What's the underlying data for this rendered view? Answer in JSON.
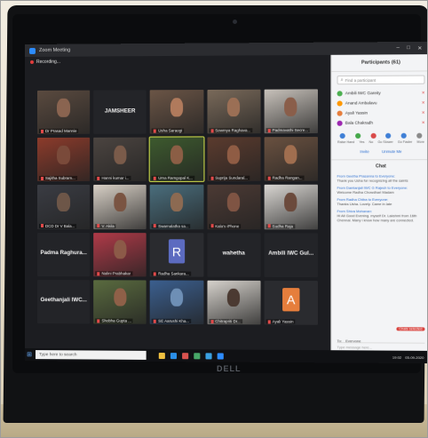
{
  "window": {
    "title": "Zoom Meeting",
    "controls": [
      "–",
      "□",
      "✕"
    ],
    "recording_label": "Recording..."
  },
  "gallery": {
    "tiles": [
      {
        "label": "Dr Prasad Mannie",
        "kind": "video",
        "bg": "#5a4a3f",
        "face": "#8a6450"
      },
      {
        "label": "JAMSHEER",
        "kind": "name"
      },
      {
        "label": "Usha Saraogi",
        "kind": "video",
        "bg": "#6b5546",
        "face": "#b07a5c"
      },
      {
        "label": "Sowmya Raghava...",
        "kind": "video",
        "bg": "#7a6a5a",
        "face": "#9b6f55"
      },
      {
        "label": "Padmavathi Secre...",
        "kind": "video",
        "bg": "#c8c2bb",
        "face": "#8a5e4a"
      },
      {
        "label": "Sajitha Subram...",
        "kind": "video",
        "bg": "#8c3b2b",
        "face": "#7a4a3a"
      },
      {
        "label": "Hanni kumar i...",
        "kind": "video",
        "bg": "#4b4440",
        "face": "#7a5b4a"
      },
      {
        "label": "Uma Ramgopal K...",
        "kind": "video",
        "bg": "#3d5a2e",
        "face": "#8b5e45",
        "active": true
      },
      {
        "label": "Suprija Sundaral...",
        "kind": "video",
        "bg": "#5b3b2e",
        "face": "#8f5c44"
      },
      {
        "label": "Radha Rangan...",
        "kind": "video",
        "bg": "#6a5140",
        "face": "#a06e4f"
      },
      {
        "label": "DCD Dr V Bala...",
        "kind": "video",
        "bg": "#3a3c43",
        "face": "#6d5648"
      },
      {
        "label": "V. Akila",
        "kind": "video",
        "bg": "#d8d0c6",
        "face": "#7a5442"
      },
      {
        "label": "Swarnalatha sa...",
        "kind": "video",
        "bg": "#4a6e7d",
        "face": "#8c6a52"
      },
      {
        "label": "Kala's iPhone",
        "kind": "video",
        "bg": "#4c3a34",
        "face": "#7f5443"
      },
      {
        "label": "Sudha Raja",
        "kind": "video",
        "bg": "#d9d6d2",
        "face": "#6b4a3c"
      },
      {
        "label": "Padma Raghura...",
        "kind": "name"
      },
      {
        "label": "Nalini Prabhakar",
        "kind": "video",
        "bg": "#b03a48",
        "face": "#8c5a48"
      },
      {
        "label": "Radha Sankara...",
        "kind": "letter",
        "letter": "R",
        "letter_bg": "#5c6bc0"
      },
      {
        "label": "wahetha",
        "kind": "name"
      },
      {
        "label": "Ambili IWC Gul...",
        "kind": "name"
      },
      {
        "label": "Geethanjali IWC...",
        "kind": "name"
      },
      {
        "label": "Shobha Gupta ...",
        "kind": "video",
        "bg": "#5a6b3f",
        "face": "#8f6048"
      },
      {
        "label": "SE Aarushi Kha...",
        "kind": "video",
        "bg": "#3b5f8f",
        "face": "#6e8fb5"
      },
      {
        "label": "Chitrapriti Dr...",
        "kind": "video",
        "bg": "#d6d2cc",
        "face": "#4b3a32"
      },
      {
        "label": "Ayali Yassin",
        "kind": "letter",
        "letter": "A",
        "letter_bg": "#e67e3c"
      }
    ]
  },
  "participants_panel": {
    "title": "Participants (61)",
    "search_placeholder": "Find a participant",
    "rows": [
      {
        "name": "Ambili IWC Gareity",
        "color": "#4caf50"
      },
      {
        "name": "Anand Ambalavu",
        "color": "#ff9800"
      },
      {
        "name": "Ayali Yassin",
        "color": "#e67e3c"
      },
      {
        "name": "Bala Chakradh",
        "color": "#9c27b0"
      }
    ],
    "reactions": [
      "Raise Hand",
      "Yes",
      "No",
      "Go Slower",
      "Go Faster",
      "More"
    ],
    "reaction_colors": [
      "#3f7fd6",
      "#45a84a",
      "#d94a4a",
      "#3f7fd6",
      "#3f7fd6",
      "#8a8a8a"
    ],
    "invite_label": "Invite",
    "unmute_label": "Unmute Me"
  },
  "chat": {
    "title": "Chat",
    "messages": [
      {
        "from": "From Geetha Prasanna to Everyone:",
        "text": "Thank you Usha for recognizing all the saints"
      },
      {
        "from": "From Damlanjali IWC G Rajesh to Everyone:",
        "text": "Welcome Radha Chowdhari Madam"
      },
      {
        "from": "From Radha Chitra to Everyone:",
        "text": "Thanks Usha. Lovely. Came in late"
      },
      {
        "from": "From Shiva Mohanan:",
        "text": "Hi All Good Evening. myself Dr. Lakshmi from 16th Chennai. Many i know how many are connected."
      }
    ],
    "to_label": "To:",
    "to_value": "Everyone",
    "select_label": "Chats selected",
    "input_placeholder": "Type message here..."
  },
  "taskbar": {
    "search_placeholder": "Type here to search",
    "tray_time": "19:02",
    "tray_date": "05-09-2020",
    "icon_colors": [
      "#f0c040",
      "#2b8fe8",
      "#d9534f",
      "#48a868",
      "#3aa0e0",
      "#2d8cff"
    ]
  },
  "laptop": {
    "brand": "DELL"
  }
}
